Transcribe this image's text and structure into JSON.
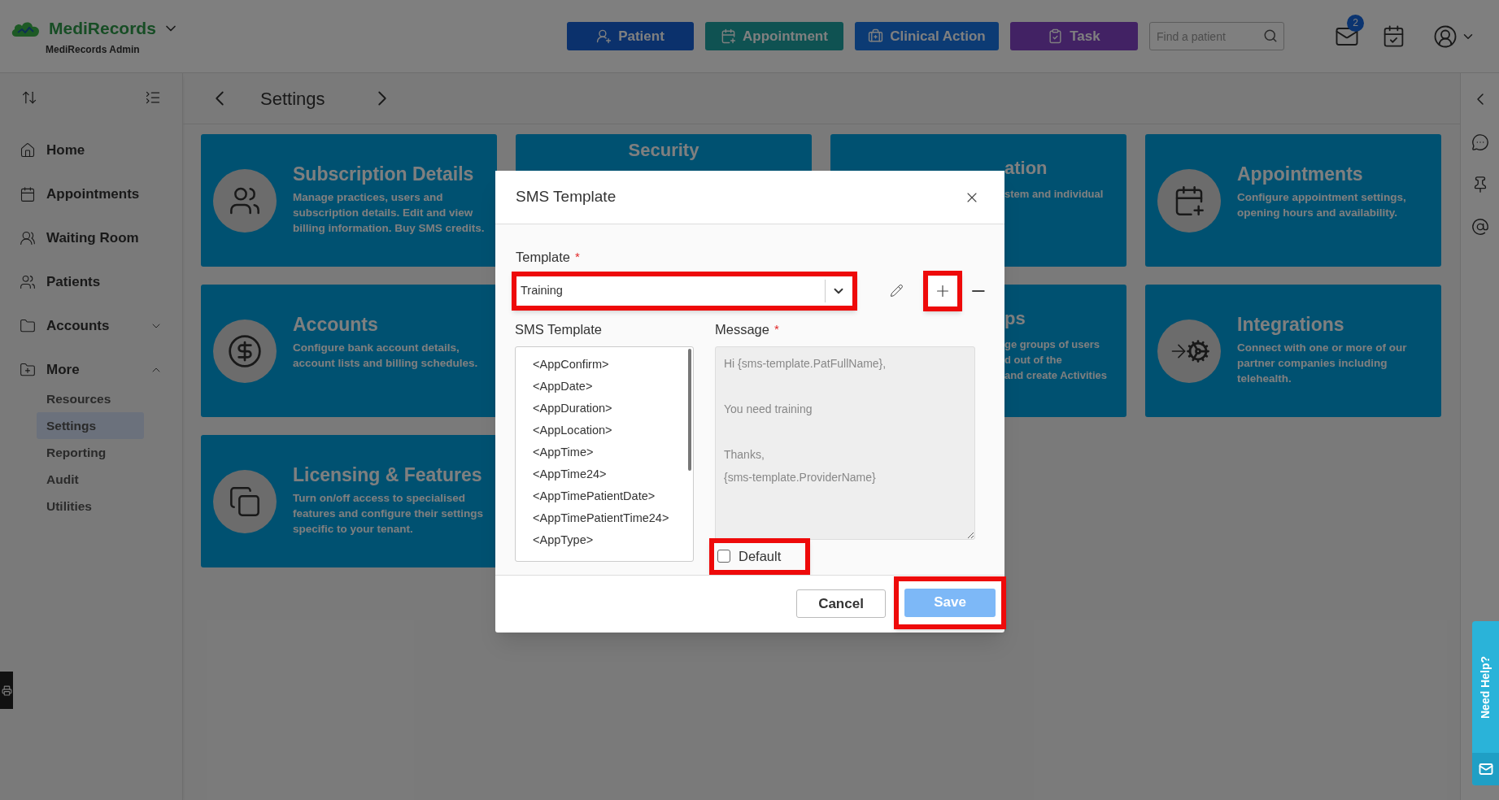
{
  "app": {
    "logo": "MediRecords",
    "subtitle": "MediRecords Admin"
  },
  "actions": [
    {
      "label": "Patient",
      "kind": "patient"
    },
    {
      "label": "Appointment",
      "kind": "appointment"
    },
    {
      "label": "Clinical Action",
      "kind": "clinical"
    },
    {
      "label": "Task",
      "kind": "task"
    }
  ],
  "search": {
    "placeholder": "Find a patient"
  },
  "notifications": {
    "count": "2"
  },
  "sidebar": {
    "items": [
      {
        "label": "Home"
      },
      {
        "label": "Appointments"
      },
      {
        "label": "Waiting Room"
      },
      {
        "label": "Patients"
      },
      {
        "label": "Accounts",
        "expanded": false
      },
      {
        "label": "More",
        "expanded": true,
        "children": [
          {
            "label": "Resources",
            "selected": false
          },
          {
            "label": "Settings",
            "selected": true
          },
          {
            "label": "Reporting",
            "selected": false
          },
          {
            "label": "Audit",
            "selected": false
          },
          {
            "label": "Utilities",
            "selected": false
          }
        ]
      }
    ]
  },
  "page": {
    "title": "Settings"
  },
  "card_rows": [
    [
      {
        "kind": "full",
        "title": "Subscription Details",
        "description": "Manage practices, users and subscription details. Edit and view billing information. Buy SMS credits."
      },
      {
        "kind": "title_only",
        "title": "Security"
      },
      {
        "kind": "partial",
        "title": "ation",
        "lines": [
          "stem and individual"
        ]
      },
      {
        "kind": "full",
        "title": "Appointments",
        "description": "Configure appointment settings, opening hours and availability."
      }
    ],
    [
      {
        "kind": "full",
        "title": "Accounts",
        "description": "Configure bank account details, account lists and billing schedules."
      },
      {
        "kind": "blank"
      },
      {
        "kind": "partial",
        "title": "ps",
        "lines": [
          "ge groups of users",
          "d out of the",
          "and create Activities"
        ]
      },
      {
        "kind": "full",
        "title": "Integrations",
        "description": "Connect with one or more of our partner companies including telehealth."
      }
    ],
    [
      {
        "kind": "full",
        "title": "Licensing & Features",
        "description": "Turn on/off access to specialised features and configure their settings specific to your tenant."
      }
    ]
  ],
  "dialog": {
    "title": "SMS Template",
    "template": {
      "label": "Template",
      "required_mark": "*",
      "value": "Training"
    },
    "variables": {
      "label": "SMS Template",
      "items": [
        "<AppConfirm>",
        "<AppDate>",
        "<AppDuration>",
        "<AppLocation>",
        "<AppTime>",
        "<AppTime24>",
        "<AppTimePatientDate>",
        "<AppTimePatientTime24>",
        "<AppType>"
      ]
    },
    "message": {
      "label": "Message",
      "required_mark": "*",
      "disabled": true,
      "value": "Hi {sms-template.PatFullName},\n\nYou need training\n\nThanks,\n{sms-template.ProviderName}"
    },
    "default": {
      "label": "Default",
      "checked": false
    },
    "buttons": [
      {
        "label": "Cancel",
        "kind": "secondary",
        "disabled": false
      },
      {
        "label": "Save",
        "kind": "primary",
        "disabled": true
      }
    ]
  },
  "help_tab": {
    "label": "Need Help?"
  }
}
